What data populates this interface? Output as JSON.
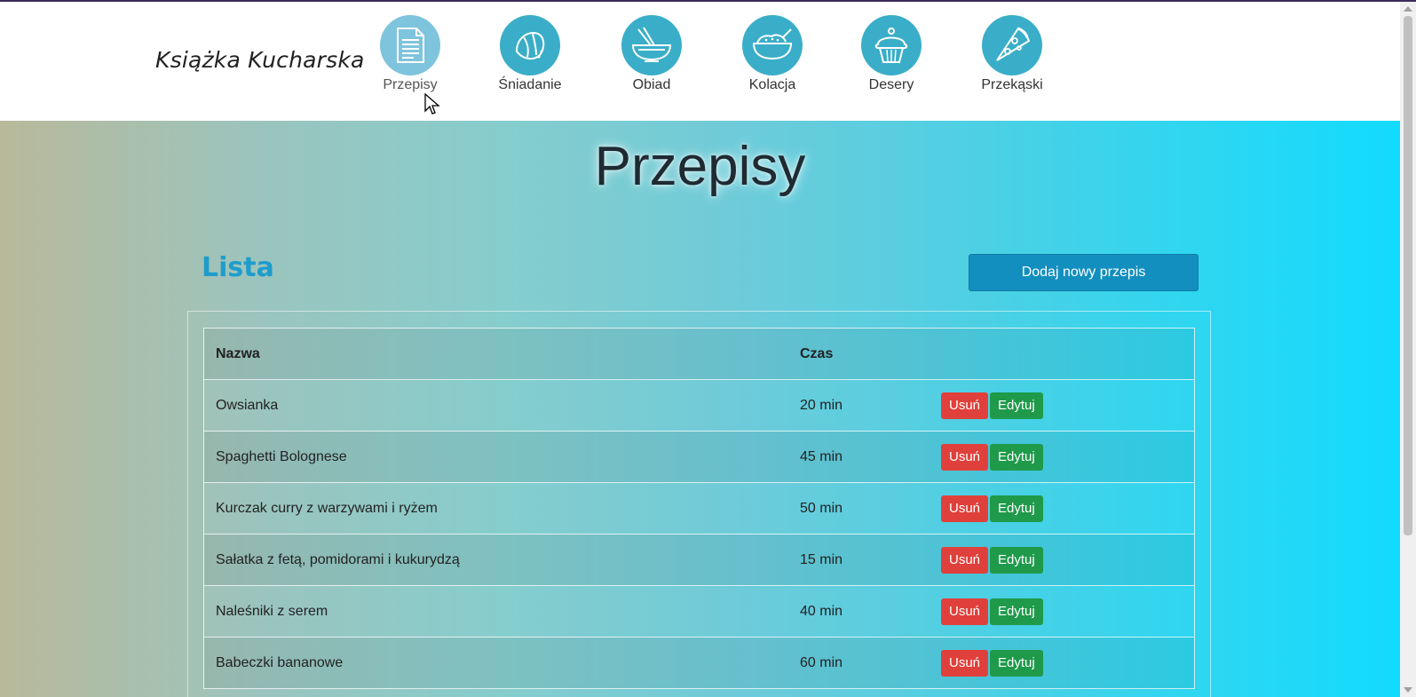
{
  "header": {
    "brand": "Książka Kucharska",
    "nav": [
      {
        "label": "Przepisy",
        "icon": "recipe-document-icon",
        "active": true
      },
      {
        "label": "Śniadanie",
        "icon": "croissant-icon"
      },
      {
        "label": "Obiad",
        "icon": "noodle-bowl-icon"
      },
      {
        "label": "Kolacja",
        "icon": "rice-bowl-icon"
      },
      {
        "label": "Desery",
        "icon": "cupcake-icon"
      },
      {
        "label": "Przekąski",
        "icon": "pizza-slice-icon"
      }
    ]
  },
  "main": {
    "title": "Przepisy",
    "list_heading": "Lista",
    "add_button": "Dodaj nowy przepis",
    "table": {
      "headers": {
        "name": "Nazwa",
        "time": "Czas"
      },
      "rows": [
        {
          "name": "Owsianka",
          "time": "20 min"
        },
        {
          "name": "Spaghetti Bolognese",
          "time": "45 min"
        },
        {
          "name": "Kurczak curry z warzywami i ryżem",
          "time": "50 min"
        },
        {
          "name": "Sałatka z fetą, pomidorami i kukurydzą",
          "time": "15 min"
        },
        {
          "name": "Naleśniki z serem",
          "time": "40 min"
        },
        {
          "name": "Babeczki bananowe",
          "time": "60 min"
        }
      ],
      "delete_label": "Usuń",
      "edit_label": "Edytuj"
    }
  },
  "colors": {
    "accent": "#1e9dcc",
    "icon_circle": "#3aaec8",
    "delete": "#e0403b",
    "edit": "#1e9a4a",
    "add_button": "#138fbf"
  }
}
